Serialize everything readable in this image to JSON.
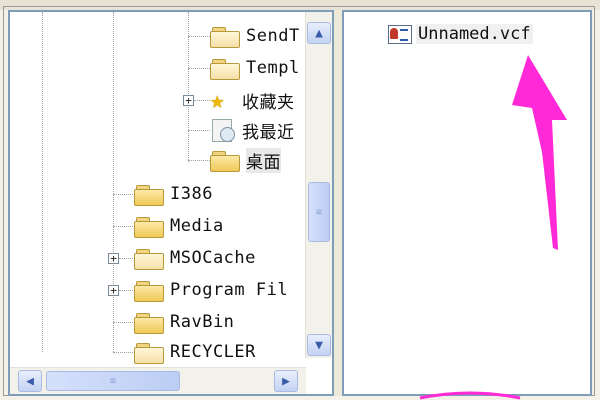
{
  "tree": {
    "items": [
      {
        "label": "SendT",
        "icon": "folder-icon"
      },
      {
        "label": "Templ",
        "icon": "folder-icon"
      },
      {
        "label": "收藏夹",
        "icon": "favorites-star-icon"
      },
      {
        "label": "我最近",
        "icon": "recent-documents-icon"
      },
      {
        "label": "桌面",
        "icon": "folder-icon"
      },
      {
        "label": "I386",
        "icon": "folder-icon"
      },
      {
        "label": "Media",
        "icon": "folder-icon"
      },
      {
        "label": "MSOCache",
        "icon": "folder-icon"
      },
      {
        "label": "Program Fil",
        "icon": "folder-icon"
      },
      {
        "label": "RavBin",
        "icon": "folder-icon"
      },
      {
        "label": "RECYCLER",
        "icon": "folder-icon"
      }
    ],
    "expander_symbol": "+"
  },
  "scrollbar": {
    "up_symbol": "▲",
    "down_symbol": "▼",
    "left_symbol": "◀",
    "right_symbol": "▶",
    "grip_symbol": "≡"
  },
  "files": [
    {
      "label": "Unnamed.vcf",
      "icon": "vcf-contact-card-icon"
    }
  ],
  "colors": {
    "arrow": "#ff29d8",
    "pane_border": "#7f9db9",
    "scroll_accent": "#3a5ca8"
  }
}
